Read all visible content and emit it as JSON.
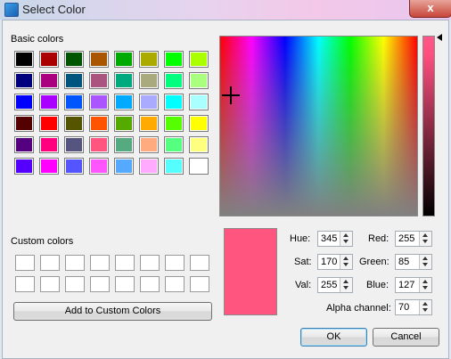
{
  "window": {
    "title": "Select Color",
    "close_glyph": "x"
  },
  "basic_colors": {
    "label": "Basic colors",
    "rows": [
      [
        "#000000",
        "#aa0000",
        "#005500",
        "#aa5500",
        "#00aa00",
        "#aaaa00",
        "#00ff00",
        "#aaff00"
      ],
      [
        "#00007f",
        "#aa007f",
        "#00557f",
        "#aa557f",
        "#00aa7f",
        "#aaaa7f",
        "#00ff7f",
        "#aaff7f"
      ],
      [
        "#0000ff",
        "#aa00ff",
        "#0055ff",
        "#aa55ff",
        "#00aaff",
        "#aaaaff",
        "#00ffff",
        "#aaffff"
      ],
      [
        "#550000",
        "#ff0000",
        "#555500",
        "#ff5500",
        "#55aa00",
        "#ffaa00",
        "#55ff00",
        "#ffff00"
      ],
      [
        "#55007f",
        "#ff007f",
        "#55557f",
        "#ff557f",
        "#55aa7f",
        "#ffaa7f",
        "#55ff7f",
        "#ffff7f"
      ],
      [
        "#5500ff",
        "#ff00ff",
        "#5555ff",
        "#ff55ff",
        "#55aaff",
        "#ffaaff",
        "#55ffff",
        "#ffffff"
      ]
    ]
  },
  "custom_colors": {
    "label": "Custom colors",
    "rows": 2,
    "cols": 8
  },
  "add_button": "Add to Custom Colors",
  "current_color": "#ff557f",
  "fields": {
    "hue": {
      "label": "Hue:",
      "value": "345"
    },
    "sat": {
      "label": "Sat:",
      "value": "170"
    },
    "val": {
      "label": "Val:",
      "value": "255"
    },
    "red": {
      "label": "Red:",
      "value": "255"
    },
    "green": {
      "label": "Green:",
      "value": "85"
    },
    "blue": {
      "label": "Blue:",
      "value": "127"
    },
    "alpha": {
      "label": "Alpha channel:",
      "value": "70"
    }
  },
  "buttons": {
    "ok": "OK",
    "cancel": "Cancel"
  }
}
